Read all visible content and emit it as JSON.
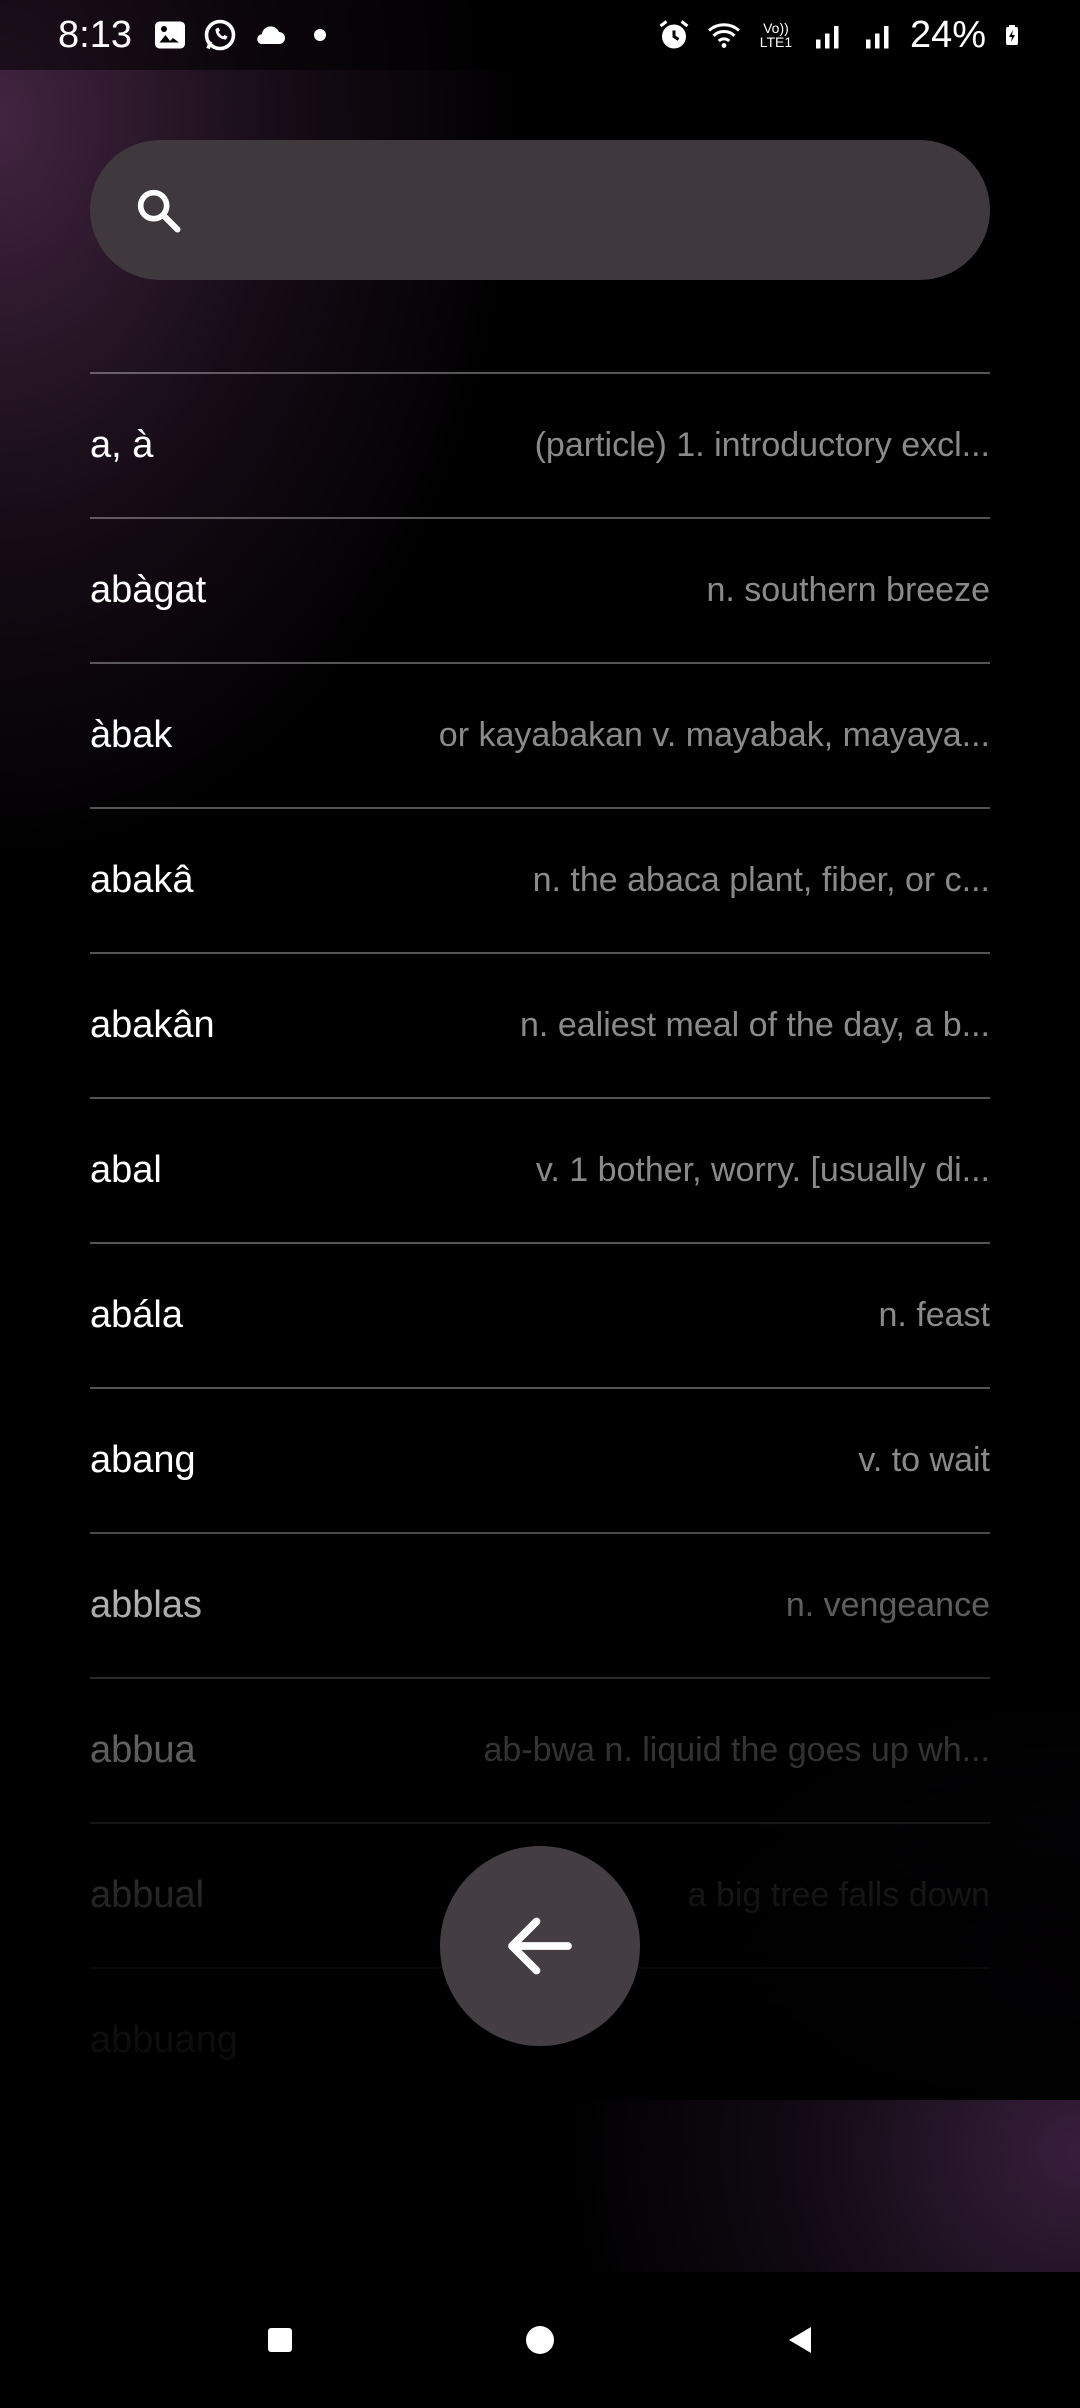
{
  "status_bar": {
    "time": "8:13",
    "battery": "24%",
    "network": "Vo)) LTE1"
  },
  "search": {
    "value": "",
    "placeholder": ""
  },
  "entries": [
    {
      "word": "a, à",
      "definition": "(particle) 1. introductory excl..."
    },
    {
      "word": "abàgat",
      "definition": "n. southern breeze"
    },
    {
      "word": "àbak",
      "definition": "or kayabakan v. mayabak, mayaya..."
    },
    {
      "word": "abakâ",
      "definition": "n. the abaca plant, fiber, or c..."
    },
    {
      "word": "abakân",
      "definition": "n. ealiest meal of the day, a b..."
    },
    {
      "word": "abal",
      "definition": "v. 1 bother, worry. [usually di..."
    },
    {
      "word": "abála",
      "definition": "n. feast"
    },
    {
      "word": "abang",
      "definition": "v. to wait"
    },
    {
      "word": "abblas",
      "definition": "n. vengeance"
    },
    {
      "word": "abbua",
      "definition": "ab-bwa n. liquid the goes up wh..."
    },
    {
      "word": "abbual",
      "definition": "a big tree falls down"
    },
    {
      "word": "abbuang",
      "definition": ""
    }
  ],
  "colors": {
    "background": "#000000",
    "accent_purple": "#46264a",
    "search_bg": "#3f393d",
    "fab_bg": "#443e42"
  },
  "icons": {
    "search": "search-icon",
    "back": "arrow-left-icon"
  }
}
